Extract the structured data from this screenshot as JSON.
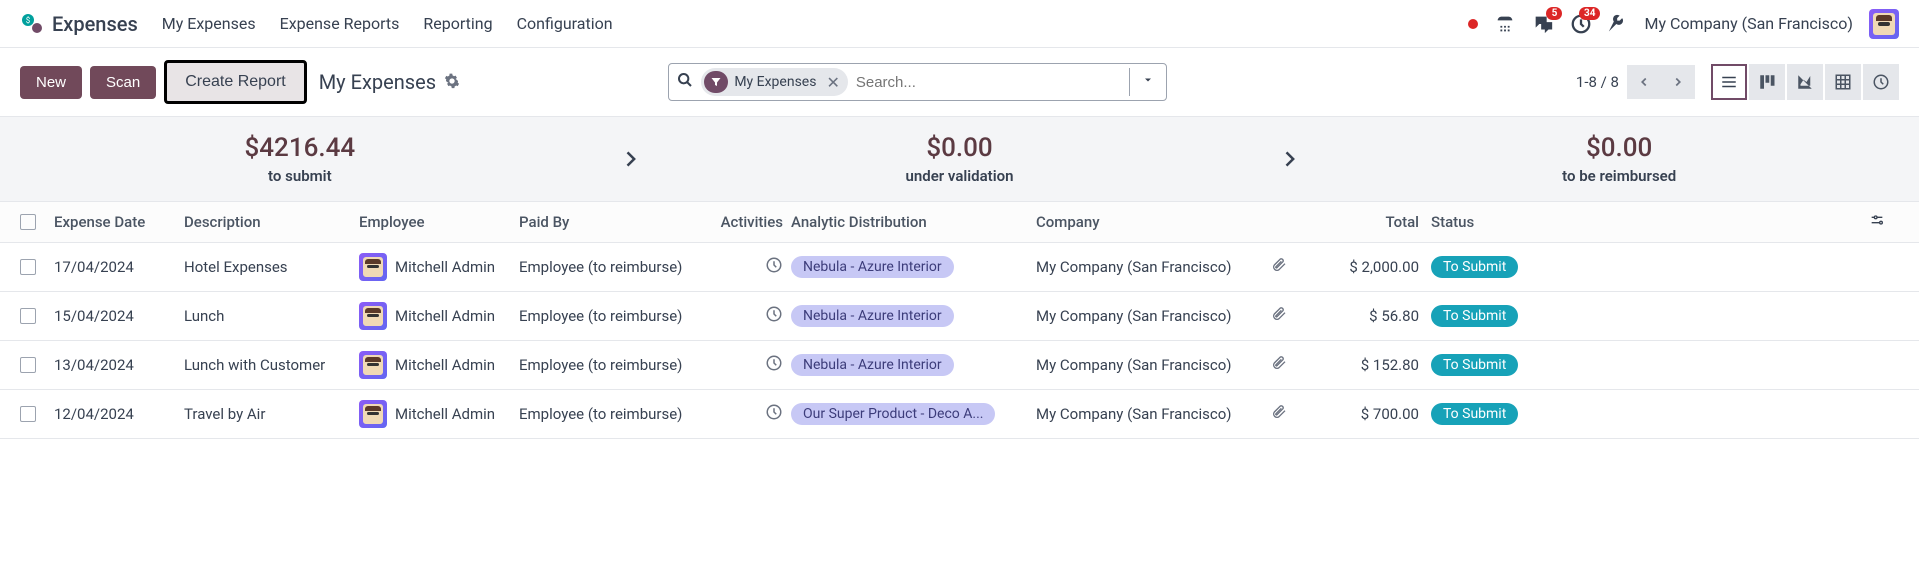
{
  "app": {
    "title": "Expenses"
  },
  "nav": {
    "items": [
      "My Expenses",
      "Expense Reports",
      "Reporting",
      "Configuration"
    ]
  },
  "topbar": {
    "messages_badge": "5",
    "activities_badge": "34",
    "company": "My Company (San Francisco)"
  },
  "toolbar": {
    "new_label": "New",
    "scan_label": "Scan",
    "create_report_label": "Create Report",
    "page_title": "My Expenses"
  },
  "search": {
    "chip_label": "My Expenses",
    "placeholder": "Search..."
  },
  "pager": {
    "text": "1-8 / 8"
  },
  "summary": {
    "to_submit_amount": "$4216.44",
    "to_submit_label": "to submit",
    "under_validation_amount": "$0.00",
    "under_validation_label": "under validation",
    "to_reimburse_amount": "$0.00",
    "to_reimburse_label": "to be reimbursed"
  },
  "table": {
    "headers": {
      "date": "Expense Date",
      "description": "Description",
      "employee": "Employee",
      "paid_by": "Paid By",
      "activities": "Activities",
      "analytic": "Analytic Distribution",
      "company": "Company",
      "total": "Total",
      "status": "Status"
    },
    "rows": [
      {
        "date": "17/04/2024",
        "description": "Hotel Expenses",
        "employee": "Mitchell Admin",
        "paid_by": "Employee (to reimburse)",
        "analytic": "Nebula - Azure Interior",
        "company": "My Company (San Francisco)",
        "total": "$ 2,000.00",
        "status": "To Submit"
      },
      {
        "date": "15/04/2024",
        "description": "Lunch",
        "employee": "Mitchell Admin",
        "paid_by": "Employee (to reimburse)",
        "analytic": "Nebula - Azure Interior",
        "company": "My Company (San Francisco)",
        "total": "$ 56.80",
        "status": "To Submit"
      },
      {
        "date": "13/04/2024",
        "description": "Lunch with Customer",
        "employee": "Mitchell Admin",
        "paid_by": "Employee (to reimburse)",
        "analytic": "Nebula - Azure Interior",
        "company": "My Company (San Francisco)",
        "total": "$ 152.80",
        "status": "To Submit"
      },
      {
        "date": "12/04/2024",
        "description": "Travel by Air",
        "employee": "Mitchell Admin",
        "paid_by": "Employee (to reimburse)",
        "analytic": "Our Super Product - Deco A...",
        "company": "My Company (San Francisco)",
        "total": "$ 700.00",
        "status": "To Submit"
      }
    ]
  }
}
